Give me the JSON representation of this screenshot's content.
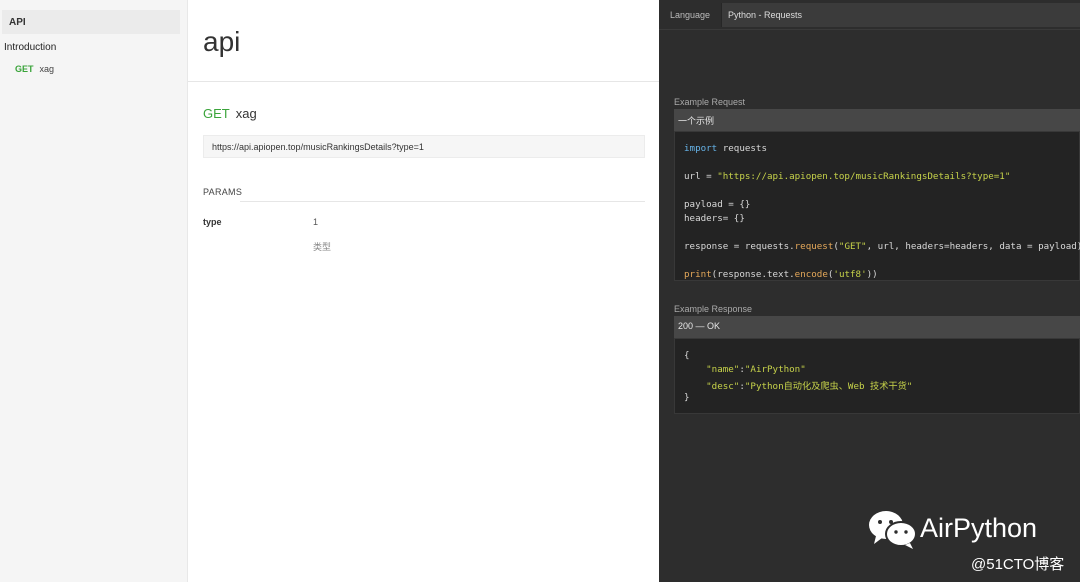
{
  "sidebar": {
    "section": "API",
    "intro": "Introduction",
    "items": [
      {
        "method": "GET",
        "label": "xag"
      }
    ]
  },
  "main": {
    "title": "api",
    "endpoint": {
      "method": "GET",
      "name": "xag"
    },
    "url": "https://api.apiopen.top/musicRankingsDetails?type=1",
    "params_label": "PARAMS",
    "params": [
      {
        "name": "type",
        "value": "1",
        "desc": "类型"
      }
    ]
  },
  "code_panel": {
    "language_label": "Language",
    "language_value": "Python - Requests",
    "request_label": "Example Request",
    "request_tab": "一个示例",
    "response_label": "Example Response",
    "response_status": "200 — OK"
  },
  "colors": {
    "get_method": "#3aa43a",
    "code_bg": "#232323",
    "panel_bg": "#2d2d2d",
    "keyword": "#66b3e8",
    "string": "#c7d34a",
    "function": "#e4a85a"
  },
  "watermark": {
    "icon": "wechat-icon",
    "name": "AirPython",
    "sub": "@51CTO博客"
  }
}
